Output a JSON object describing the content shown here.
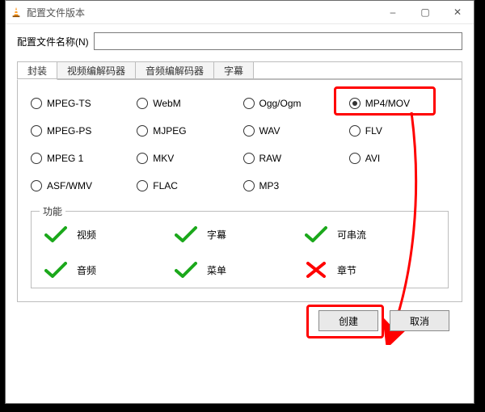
{
  "window": {
    "title": "配置文件版本",
    "minimize": "–",
    "maximize": "▢",
    "close": "✕"
  },
  "name_row": {
    "label": "配置文件名称(N)",
    "value": ""
  },
  "tabs": [
    {
      "id": "encap",
      "label": "封装",
      "active": true
    },
    {
      "id": "video",
      "label": "视频编解码器",
      "active": false
    },
    {
      "id": "audio",
      "label": "音频编解码器",
      "active": false
    },
    {
      "id": "subtitle",
      "label": "字幕",
      "active": false
    }
  ],
  "formats": [
    {
      "id": "mpeg-ts",
      "label": "MPEG-TS",
      "selected": false
    },
    {
      "id": "webm",
      "label": "WebM",
      "selected": false
    },
    {
      "id": "ogg",
      "label": "Ogg/Ogm",
      "selected": false
    },
    {
      "id": "mp4",
      "label": "MP4/MOV",
      "selected": true
    },
    {
      "id": "mpeg-ps",
      "label": "MPEG-PS",
      "selected": false
    },
    {
      "id": "mjpeg",
      "label": "MJPEG",
      "selected": false
    },
    {
      "id": "wav",
      "label": "WAV",
      "selected": false
    },
    {
      "id": "flv",
      "label": "FLV",
      "selected": false
    },
    {
      "id": "mpeg1",
      "label": "MPEG 1",
      "selected": false
    },
    {
      "id": "mkv",
      "label": "MKV",
      "selected": false
    },
    {
      "id": "raw",
      "label": "RAW",
      "selected": false
    },
    {
      "id": "avi",
      "label": "AVI",
      "selected": false
    },
    {
      "id": "asf",
      "label": "ASF/WMV",
      "selected": false
    },
    {
      "id": "flac",
      "label": "FLAC",
      "selected": false
    },
    {
      "id": "mp3",
      "label": "MP3",
      "selected": false
    }
  ],
  "features": {
    "legend": "功能",
    "items": [
      {
        "id": "video",
        "label": "视频",
        "ok": true
      },
      {
        "id": "subtitle",
        "label": "字幕",
        "ok": true
      },
      {
        "id": "stream",
        "label": "可串流",
        "ok": true
      },
      {
        "id": "audio",
        "label": "音频",
        "ok": true
      },
      {
        "id": "menu",
        "label": "菜单",
        "ok": true
      },
      {
        "id": "chapter",
        "label": "章节",
        "ok": false
      }
    ]
  },
  "buttons": {
    "create": "创建",
    "cancel": "取消"
  },
  "highlights": {
    "mp4": true,
    "create": true,
    "arrow": true
  }
}
